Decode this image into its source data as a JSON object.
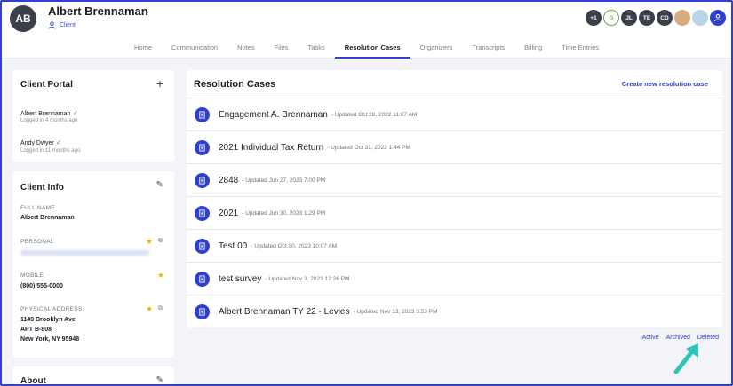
{
  "header": {
    "avatar_initials": "AB",
    "client_name": "Albert Brennaman",
    "client_type": "Client",
    "team": [
      {
        "label": "+1",
        "style": "dark"
      },
      {
        "label": "G",
        "style": "green"
      },
      {
        "label": "JL",
        "style": "dark"
      },
      {
        "label": "TE",
        "style": "dark"
      },
      {
        "label": "CD",
        "style": "dark"
      },
      {
        "label": "",
        "style": "photo"
      },
      {
        "label": "",
        "style": "photo2"
      },
      {
        "label": "",
        "style": "blue"
      }
    ]
  },
  "tabs": [
    "Home",
    "Communication",
    "Notes",
    "Files",
    "Tasks",
    "Resolution Cases",
    "Organizers",
    "Transcripts",
    "Billing",
    "Time Entries"
  ],
  "active_tab": "Resolution Cases",
  "client_portal": {
    "title": "Client Portal",
    "users": [
      {
        "name": "Albert Brennaman",
        "status": "Logged in 4 months ago"
      },
      {
        "name": "Andy Dwyer",
        "status": "Logged in 11 months ago"
      }
    ]
  },
  "client_info": {
    "title": "Client Info",
    "full_name_label": "FULL NAME",
    "full_name": "Albert Brennaman",
    "personal_label": "PERSONAL",
    "mobile_label": "MOBILE",
    "mobile": "(800) 555-0000",
    "address_label": "PHYSICAL ADDRESS",
    "address_line1": "1149 Brooklyn Ave",
    "address_line2": "APT B-808",
    "address_line3": "New York, NY 95948"
  },
  "about": {
    "title": "About"
  },
  "resolution_cases": {
    "title": "Resolution Cases",
    "create_label": "Create new resolution case",
    "items": [
      {
        "name": "Engagement A. Brennaman",
        "updated": "- Updated Oct 28, 2022 11:07 AM"
      },
      {
        "name": "2021 Individual Tax Return",
        "updated": "- Updated Oct 31, 2022 1:44 PM"
      },
      {
        "name": "2848",
        "updated": "- Updated Jun 27, 2023 7:00 PM"
      },
      {
        "name": "2021",
        "updated": "- Updated Jun 30, 2023 1:29 PM"
      },
      {
        "name": "Test 00",
        "updated": "- Updated Oct 30, 2023 10:07 AM"
      },
      {
        "name": "test survey",
        "updated": "- Updated Nov 3, 2023 12:26 PM"
      },
      {
        "name": "Albert Brennaman TY 22 - Levies",
        "updated": "- Updated Nov 13, 2023 3:53 PM"
      }
    ]
  },
  "filters": {
    "active": "Active",
    "archived": "Archived",
    "deleted": "Deleted"
  },
  "colors": {
    "accent": "#2f3fd0",
    "arrow": "#2ec4b6",
    "star": "#f0b400",
    "check": "#49a14a"
  }
}
